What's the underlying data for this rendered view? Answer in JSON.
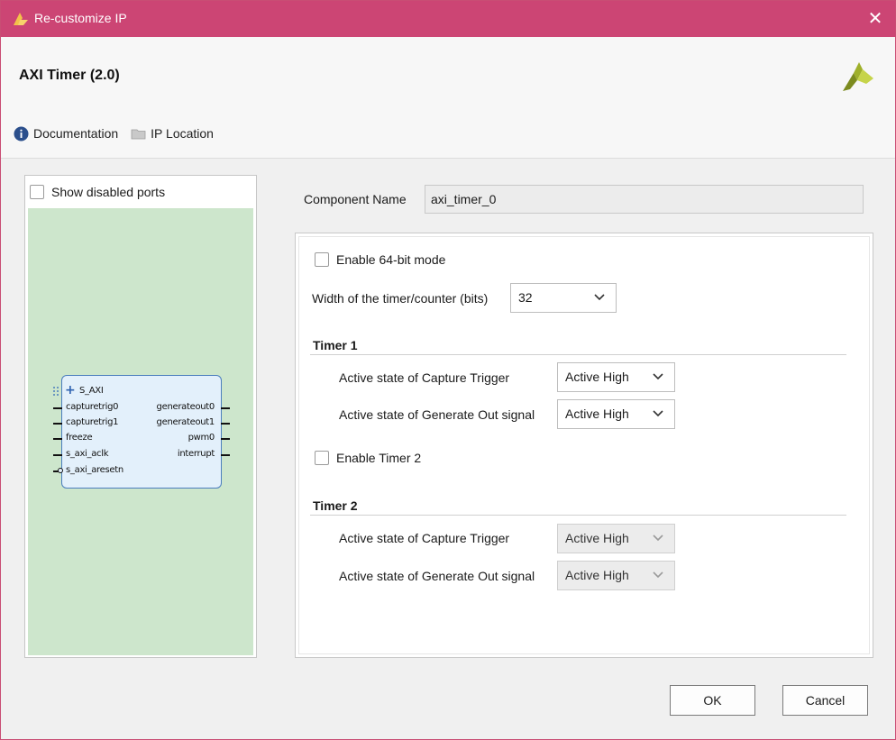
{
  "window": {
    "title": "Re-customize IP",
    "close_glyph": "✕"
  },
  "header": {
    "ip_title": "AXI Timer (2.0)",
    "logo_icon": "vivado-logo-icon"
  },
  "links": [
    {
      "label": "Documentation",
      "icon": "info-icon"
    },
    {
      "label": "IP Location",
      "icon": "folder-icon"
    }
  ],
  "left_panel": {
    "show_disabled_ports_label": "Show disabled ports",
    "show_disabled_ports_checked": false,
    "block": {
      "bus_port": "S_AXI",
      "left_ports": [
        "capturetrig0",
        "capturetrig1",
        "freeze",
        "s_axi_aclk",
        "s_axi_aresetn"
      ],
      "right_ports": [
        "generateout0",
        "generateout1",
        "pwm0",
        "interrupt"
      ]
    }
  },
  "component": {
    "label": "Component Name",
    "value": "axi_timer_0"
  },
  "options": {
    "enable_64bit": {
      "label": "Enable 64-bit mode",
      "checked": false
    },
    "width": {
      "label": "Width of the timer/counter (bits)",
      "value": "32"
    },
    "timer1": {
      "title": "Timer 1",
      "capture_label": "Active state of Capture Trigger",
      "capture_value": "Active High",
      "generate_label": "Active state of Generate Out signal",
      "generate_value": "Active High"
    },
    "enable_timer2": {
      "label": "Enable Timer 2",
      "checked": false
    },
    "timer2": {
      "title": "Timer 2",
      "capture_label": "Active state of Capture Trigger",
      "capture_value": "Active High",
      "generate_label": "Active state of Generate Out signal",
      "generate_value": "Active High"
    }
  },
  "buttons": {
    "ok": "OK",
    "cancel": "Cancel"
  },
  "colors": {
    "titlebar": "#cc4574",
    "canvas": "#cde6cc",
    "block_fill": "#e3f0fb",
    "block_border": "#4a7dbd"
  }
}
